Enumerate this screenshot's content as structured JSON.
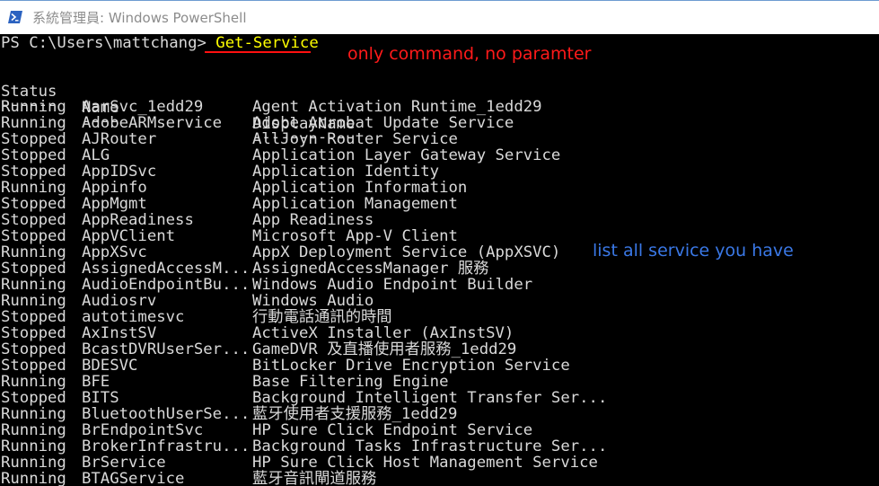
{
  "window": {
    "title": "系統管理員: Windows PowerShell",
    "icon": "powershell-icon"
  },
  "console": {
    "prompt": "PS C:\\Users\\mattchang> ",
    "command": "Get-Service",
    "headers": {
      "status": "Status",
      "name": "Name",
      "display": "DisplayName"
    },
    "separators": {
      "status": "------",
      "name": "----",
      "display": "-----------"
    },
    "rows": [
      {
        "status": "Running",
        "name": "AarSvc_1edd29",
        "display": "Agent Activation Runtime_1edd29"
      },
      {
        "status": "Running",
        "name": "AdobeARMservice",
        "display": "Adobe Acrobat Update Service"
      },
      {
        "status": "Stopped",
        "name": "AJRouter",
        "display": "AllJoyn Router Service"
      },
      {
        "status": "Stopped",
        "name": "ALG",
        "display": "Application Layer Gateway Service"
      },
      {
        "status": "Stopped",
        "name": "AppIDSvc",
        "display": "Application Identity"
      },
      {
        "status": "Running",
        "name": "Appinfo",
        "display": "Application Information"
      },
      {
        "status": "Stopped",
        "name": "AppMgmt",
        "display": "Application Management"
      },
      {
        "status": "Stopped",
        "name": "AppReadiness",
        "display": "App Readiness"
      },
      {
        "status": "Stopped",
        "name": "AppVClient",
        "display": "Microsoft App-V Client"
      },
      {
        "status": "Running",
        "name": "AppXSvc",
        "display": "AppX Deployment Service (AppXSVC)"
      },
      {
        "status": "Stopped",
        "name": "AssignedAccessM...",
        "display": "AssignedAccessManager 服務"
      },
      {
        "status": "Running",
        "name": "AudioEndpointBu...",
        "display": "Windows Audio Endpoint Builder"
      },
      {
        "status": "Running",
        "name": "Audiosrv",
        "display": "Windows Audio"
      },
      {
        "status": "Stopped",
        "name": "autotimesvc",
        "display": "行動電話通訊的時間"
      },
      {
        "status": "Stopped",
        "name": "AxInstSV",
        "display": "ActiveX Installer (AxInstSV)"
      },
      {
        "status": "Stopped",
        "name": "BcastDVRUserSer...",
        "display": "GameDVR 及直播使用者服務_1edd29"
      },
      {
        "status": "Stopped",
        "name": "BDESVC",
        "display": "BitLocker Drive Encryption Service"
      },
      {
        "status": "Running",
        "name": "BFE",
        "display": "Base Filtering Engine"
      },
      {
        "status": "Stopped",
        "name": "BITS",
        "display": "Background Intelligent Transfer Ser..."
      },
      {
        "status": "Running",
        "name": "BluetoothUserSe...",
        "display": "藍牙使用者支援服務_1edd29"
      },
      {
        "status": "Running",
        "name": "BrEndpointSvc",
        "display": "HP Sure Click Endpoint Service"
      },
      {
        "status": "Running",
        "name": "BrokerInfrastru...",
        "display": "Background Tasks Infrastructure Ser..."
      },
      {
        "status": "Running",
        "name": "BrService",
        "display": "HP Sure Click Host Management Service"
      },
      {
        "status": "Running",
        "name": "BTAGService",
        "display": "藍牙音訊閘道服務"
      }
    ]
  },
  "annotations": {
    "command_note": "only command, no paramter",
    "list_note": "list all service you have"
  },
  "colors": {
    "terminal_bg": "#000000",
    "terminal_text": "#d9d9d9",
    "command_text": "#ffff00",
    "annotation_red": "#ff1a1a",
    "annotation_blue": "#3a78e6"
  }
}
